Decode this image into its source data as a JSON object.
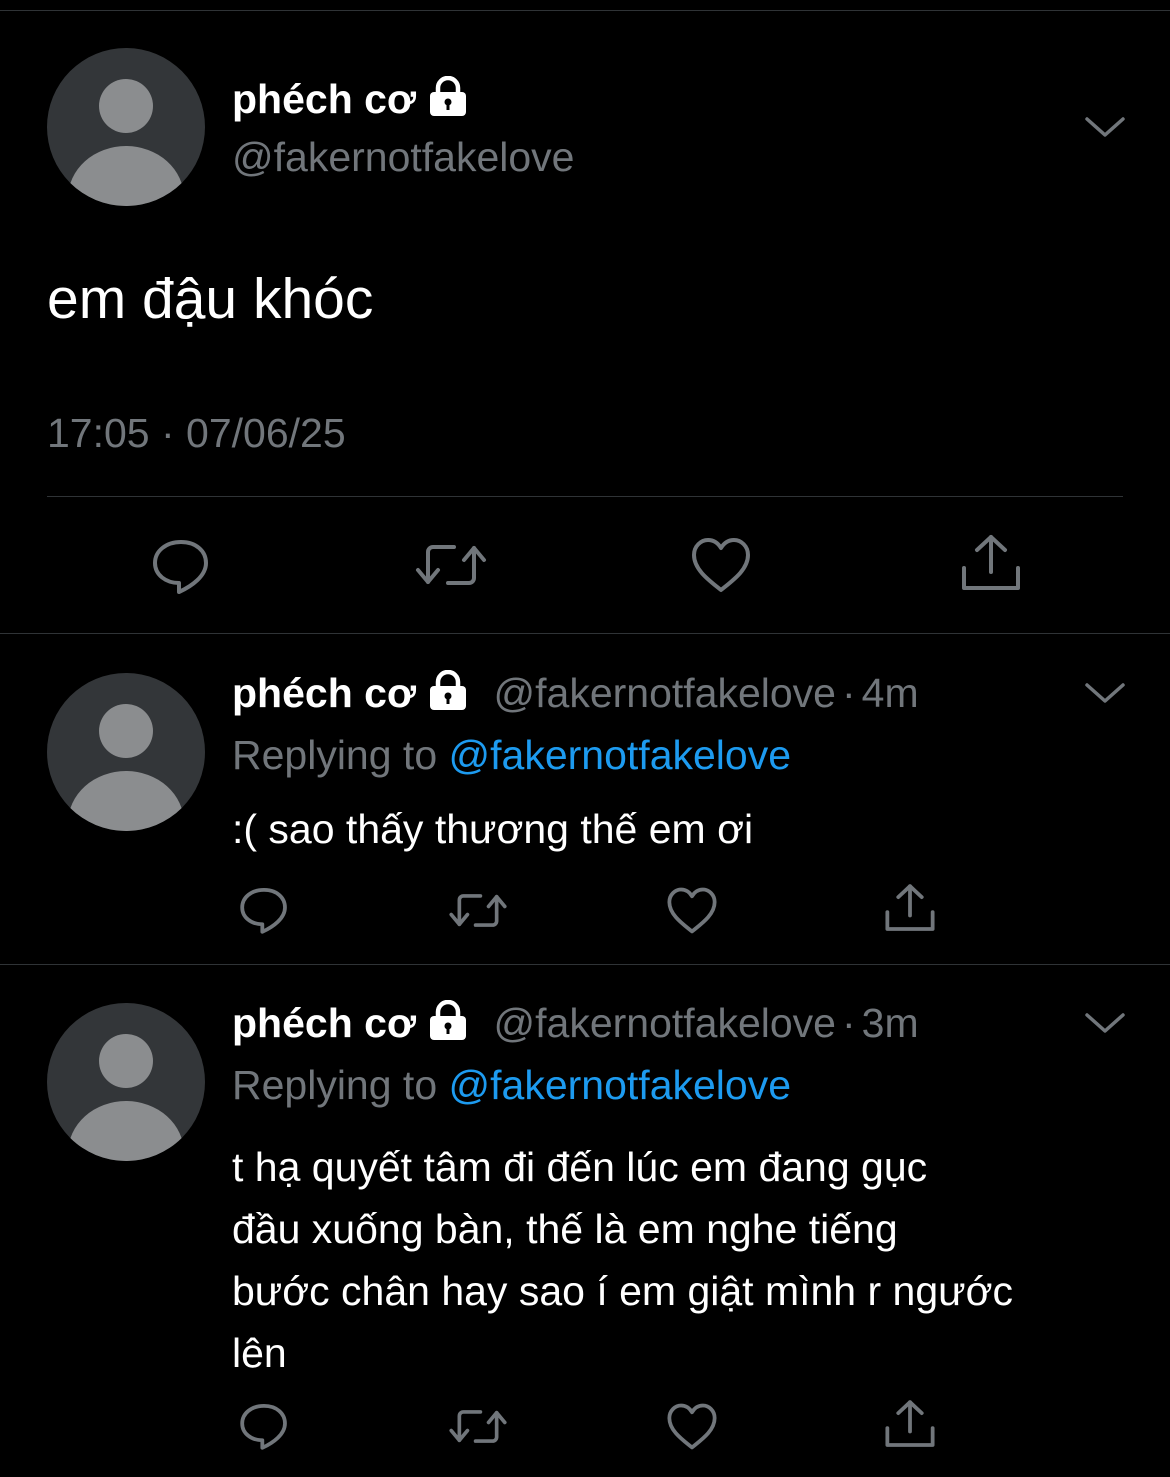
{
  "main_tweet": {
    "display_name": "phéch cơ",
    "handle": "@fakernotfakelove",
    "text": "em đậu khóc",
    "timestamp": "17:05 · 07/06/25",
    "icons": [
      "reply-icon",
      "retweet-icon",
      "like-icon",
      "share-icon"
    ]
  },
  "replies": [
    {
      "display_name": "phéch cơ",
      "handle": "@fakernotfakelove",
      "time": "4m",
      "replying_label": "Replying to",
      "replying_to": "@fakernotfakelove",
      "text": ":( sao thấy thương thế em ơi"
    },
    {
      "display_name": "phéch cơ",
      "handle": "@fakernotfakelove",
      "time": "3m",
      "replying_label": "Replying to",
      "replying_to": "@fakernotfakelove",
      "text_lines": [
        "t hạ quyết tâm đi đến lúc em đang gục",
        "đầu xuống bàn, thế là em nghe tiếng",
        "bước chân hay sao í em giật mình r ngước",
        "lên"
      ]
    }
  ],
  "colors": {
    "background": "#000000",
    "text": "#e7e9ea",
    "muted": "#71767b",
    "link": "#1d9bf0",
    "divider": "#2f3336"
  }
}
